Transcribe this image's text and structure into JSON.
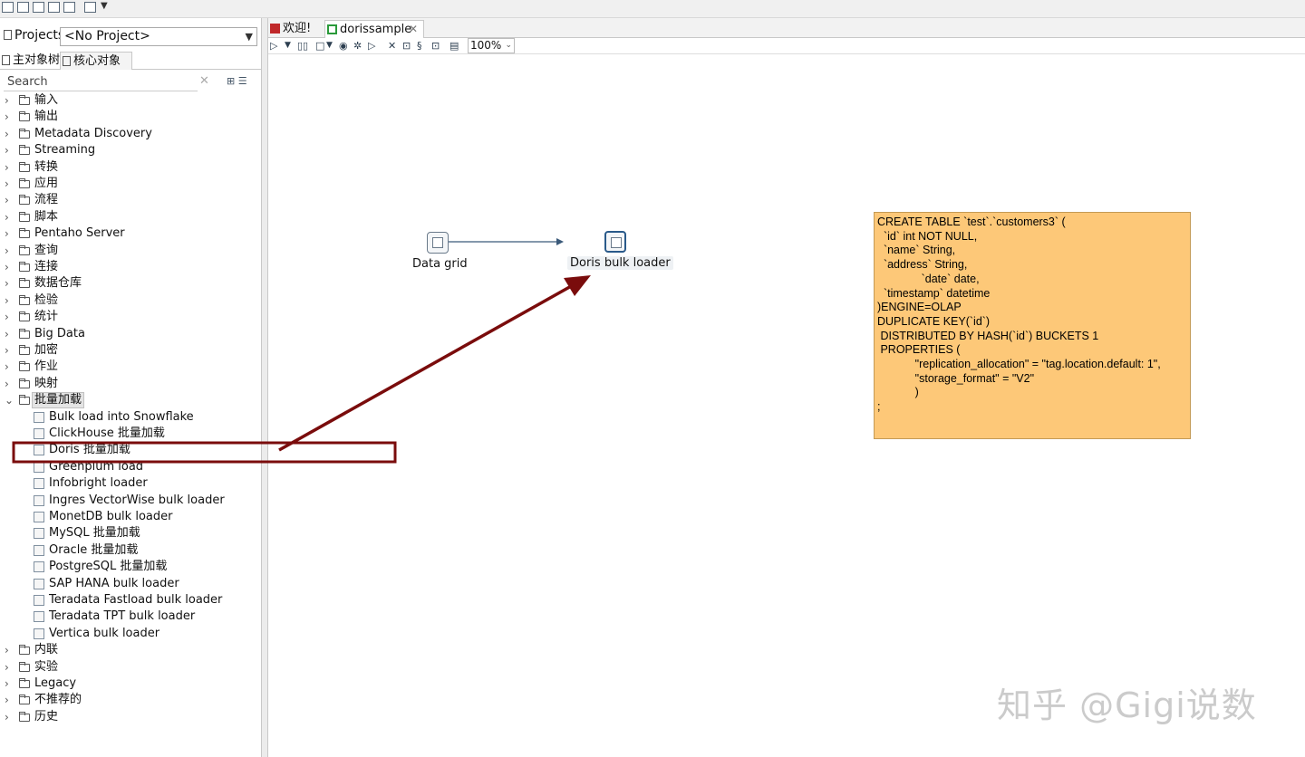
{
  "projects": {
    "label": "Projects",
    "selected": "<No Project>"
  },
  "left_tabs": [
    "主对象树",
    "核心对象"
  ],
  "search": {
    "placeholder": "Search"
  },
  "tree": {
    "categories_top": [
      "输入",
      "输出",
      "Metadata Discovery",
      "Streaming",
      "转换",
      "应用",
      "流程",
      "脚本",
      "Pentaho Server",
      "查询",
      "连接",
      "数据仓库",
      "检验",
      "统计",
      "Big Data",
      "加密",
      "作业",
      "映射"
    ],
    "expanded_category": "批量加载",
    "steps": [
      "Bulk load into Snowflake",
      "ClickHouse 批量加载",
      "Doris 批量加载",
      "Greenplum load",
      "Infobright loader",
      "Ingres VectorWise bulk loader",
      "MonetDB bulk loader",
      "MySQL 批量加载",
      "Oracle 批量加载",
      "PostgreSQL 批量加载",
      "SAP HANA bulk loader",
      "Teradata Fastload bulk loader",
      "Teradata TPT bulk loader",
      "Vertica bulk loader"
    ],
    "categories_bottom": [
      "内联",
      "实验",
      "Legacy",
      "不推荐的",
      "历史"
    ]
  },
  "editor_tabs": [
    "欢迎!",
    "dorissample"
  ],
  "zoom": "100%",
  "canvas": {
    "steps": [
      "Data grid",
      "Doris bulk loader"
    ],
    "note": "CREATE TABLE `test`.`customers3` (\n  `id` int NOT NULL,\n  `name` String,\n  `address` String,\n              `date` date,\n  `timestamp` datetime\n)ENGINE=OLAP\nDUPLICATE KEY(`id`)\n DISTRIBUTED BY HASH(`id`) BUCKETS 1\n PROPERTIES (\n            \"replication_allocation\" = \"tag.location.default: 1\",\n            \"storage_format\" = \"V2\"\n            )\n;"
  },
  "watermark": "知乎 @Gigi说数",
  "colors": {
    "note_bg": "#fdc878",
    "annotation": "#7a0c0c",
    "hop": "#3b5a7a"
  }
}
